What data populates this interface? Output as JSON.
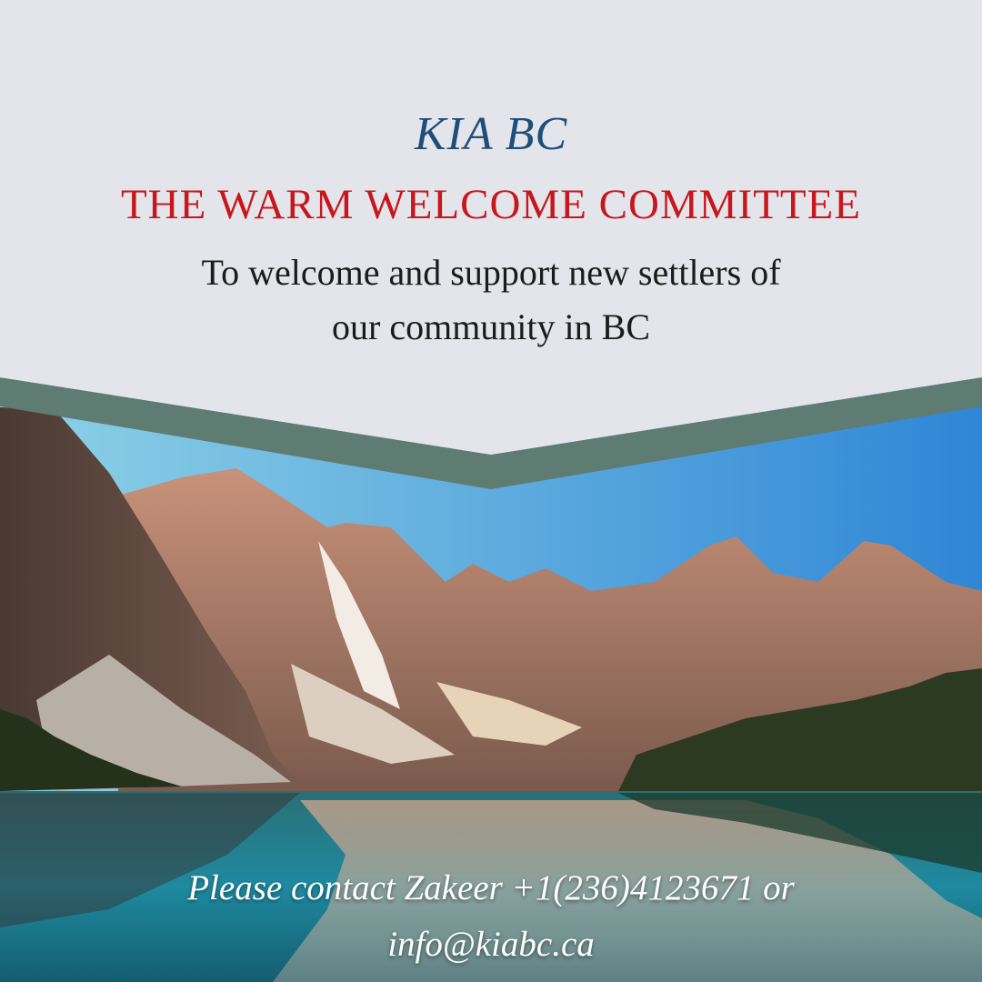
{
  "header": {
    "org_name": "KIA BC",
    "committee_name": "THE WARM WELCOME COMMITTEE",
    "tagline_line1": "To welcome and support new settlers of",
    "tagline_line2": "our community in BC"
  },
  "footer": {
    "contact_line1": "Please contact Zakeer +1(236)4123671 or",
    "contact_line2": "info@kiabc.ca"
  },
  "colors": {
    "org_name": "#1f4e79",
    "committee_name": "#c8161d",
    "chevron_band": "#5e7c72",
    "background": "#e4e5ea"
  }
}
